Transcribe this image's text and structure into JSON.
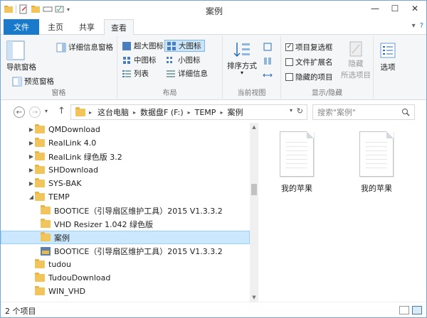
{
  "window": {
    "title": "案例",
    "controls": {
      "minimize": "—",
      "maximize": "☐",
      "close": "✕"
    }
  },
  "tabs": {
    "file": "文件",
    "items": [
      "主页",
      "共享",
      "查看"
    ],
    "active_index": 2
  },
  "ribbon": {
    "pane_group": {
      "label": "窗格",
      "nav_pane": "导航窗格",
      "preview_pane": "预览窗格",
      "details_pane": "详细信息窗格"
    },
    "layout_group": {
      "label": "布局",
      "options": [
        "超大图标",
        "大图标",
        "中图标",
        "小图标",
        "列表",
        "详细信息"
      ],
      "selected": "大图标"
    },
    "view_group": {
      "label": "当前视图",
      "sort_by": "排序方式"
    },
    "showhide_group": {
      "label": "显示/隐藏",
      "item_checkboxes": "项目复选框",
      "item_checkboxes_checked": true,
      "file_extensions": "文件扩展名",
      "file_extensions_checked": false,
      "hidden_items": "隐藏的项目",
      "hidden_items_checked": false,
      "hide_selected": "隐藏\n所选项目",
      "hide_label_1": "隐藏",
      "hide_label_2": "所选项目"
    },
    "options": "选项"
  },
  "address": {
    "segments": [
      "这台电脑",
      "数据盘F (F:)",
      "TEMP",
      "案例"
    ],
    "search_placeholder": "搜索\"案例\""
  },
  "tree": [
    {
      "label": "QMDownload",
      "indent": 0,
      "expander": "▶"
    },
    {
      "label": "RealLink 4.0",
      "indent": 0,
      "expander": "▶"
    },
    {
      "label": "RealLink 绿色版 3.2",
      "indent": 0,
      "expander": "▶"
    },
    {
      "label": "SHDownload",
      "indent": 0,
      "expander": "▶"
    },
    {
      "label": "SYS-BAK",
      "indent": 0,
      "expander": "▶"
    },
    {
      "label": "TEMP",
      "indent": 0,
      "expander": "◢"
    },
    {
      "label": "BOOTICE（引导扇区维护工具）2015 V1.3.3.2",
      "indent": 1,
      "expander": ""
    },
    {
      "label": "VHD Resizer 1.042 绿色版",
      "indent": 1,
      "expander": ""
    },
    {
      "label": "案例",
      "indent": 1,
      "expander": "",
      "selected": true
    },
    {
      "label": "BOOTICE（引导扇区维护工具）2015 V1.3.3.2",
      "indent": 1,
      "expander": "",
      "app": true
    },
    {
      "label": "tudou",
      "indent": 0,
      "expander": ""
    },
    {
      "label": "TudouDownload",
      "indent": 0,
      "expander": ""
    },
    {
      "label": "WIN_VHD",
      "indent": 0,
      "expander": ""
    }
  ],
  "files": [
    {
      "name": "我的苹果"
    },
    {
      "name": "我的苹果"
    }
  ],
  "status": {
    "count": "2 个项目"
  }
}
